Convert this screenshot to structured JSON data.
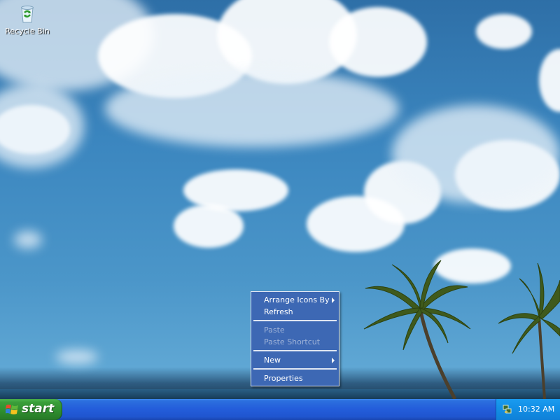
{
  "desktop": {
    "icons": [
      {
        "label": "Recycle Bin",
        "icon": "recycle-bin-icon"
      }
    ]
  },
  "context_menu": {
    "items": [
      {
        "label": "Arrange Icons By",
        "submenu": true,
        "disabled": false
      },
      {
        "label": "Refresh",
        "submenu": false,
        "disabled": false
      },
      {
        "label": "Paste",
        "submenu": false,
        "disabled": true
      },
      {
        "label": "Paste Shortcut",
        "submenu": false,
        "disabled": true
      },
      {
        "label": "New",
        "submenu": true,
        "disabled": false
      },
      {
        "label": "Properties",
        "submenu": false,
        "disabled": false
      }
    ]
  },
  "taskbar": {
    "start_label": "start",
    "clock": "10:32 AM",
    "tray_icon": "network-icon"
  },
  "colors": {
    "menu_background": "#3d68b4",
    "menu_disabled_text": "#9fb3d8",
    "taskbar": "#245edb",
    "start_button": "#3a9e3a",
    "tray": "#1390e6"
  }
}
